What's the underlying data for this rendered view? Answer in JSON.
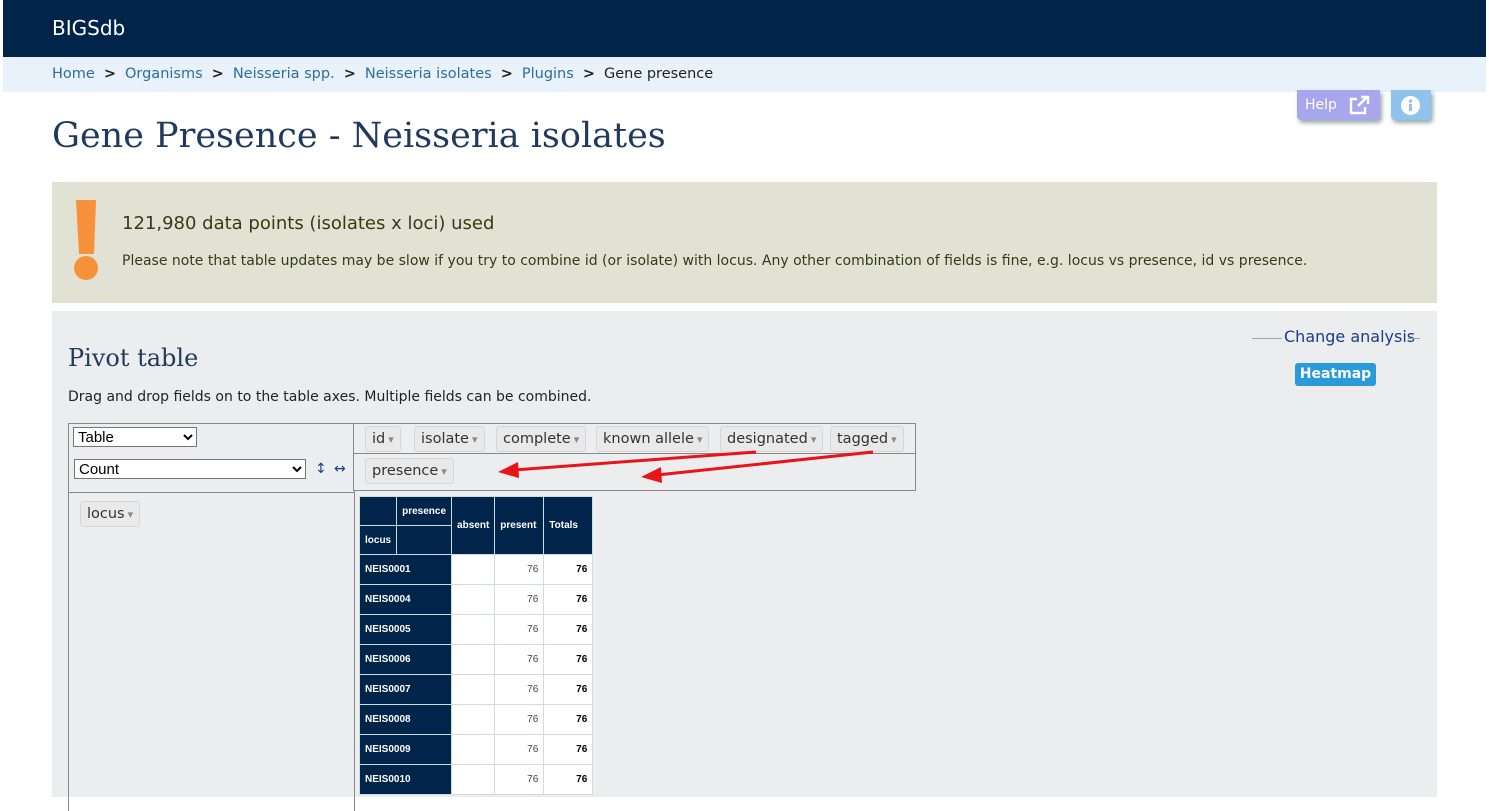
{
  "app": {
    "brand": "BIGSdb"
  },
  "breadcrumb": {
    "items": [
      "Home",
      "Organisms",
      "Neisseria spp.",
      "Neisseria isolates",
      "Plugins"
    ],
    "current": "Gene presence",
    "separator": ">"
  },
  "toolbar": {
    "help_label": "Help"
  },
  "page": {
    "title": "Gene Presence - Neisseria isolates"
  },
  "notice": {
    "headline": "121,980 data points (isolates x loci) used",
    "message": "Please note that table updates may be slow if you try to combine id (or isolate) with locus. Any other combination of fields is fine, e.g. locus vs presence, id vs presence."
  },
  "pivot": {
    "title": "Pivot table",
    "description": "Drag and drop fields on to the table axes. Multiple fields can be combined.",
    "change_analysis_label": "Change analysis",
    "heatmap_label": "Heatmap",
    "renderer_selected": "Table",
    "aggregator_selected": "Count",
    "sort_row_icon": "↕",
    "sort_col_icon": "↔",
    "unused_fields": [
      "id",
      "isolate",
      "complete",
      "known allele",
      "designated",
      "tagged"
    ],
    "col_fields": [
      "presence"
    ],
    "row_fields": [
      "locus"
    ],
    "dropdown_glyph": "▾",
    "arrow_color": "#e8141a",
    "table": {
      "col_attr": "presence",
      "row_attr": "locus",
      "col_headers": [
        "absent",
        "present"
      ],
      "totals_label": "Totals",
      "rows": [
        {
          "locus": "NEIS0001",
          "absent": "",
          "present": "76",
          "total": "76"
        },
        {
          "locus": "NEIS0004",
          "absent": "",
          "present": "76",
          "total": "76"
        },
        {
          "locus": "NEIS0005",
          "absent": "",
          "present": "76",
          "total": "76"
        },
        {
          "locus": "NEIS0006",
          "absent": "",
          "present": "76",
          "total": "76"
        },
        {
          "locus": "NEIS0007",
          "absent": "",
          "present": "76",
          "total": "76"
        },
        {
          "locus": "NEIS0008",
          "absent": "",
          "present": "76",
          "total": "76"
        },
        {
          "locus": "NEIS0009",
          "absent": "",
          "present": "76",
          "total": "76"
        },
        {
          "locus": "NEIS0010",
          "absent": "",
          "present": "76",
          "total": "76"
        }
      ]
    }
  },
  "colors": {
    "header_bg": "#00244a",
    "breadcrumb_bg": "#e9f1fb",
    "notice_bg": "#e1e2d4",
    "notice_icon": "#f7923a",
    "panel_bg": "#ecedef",
    "heatmap_bg": "#2a9ad9"
  },
  "icons": {
    "help": "external-link-icon",
    "info": "info-circle-icon",
    "notice": "exclamation-icon"
  }
}
